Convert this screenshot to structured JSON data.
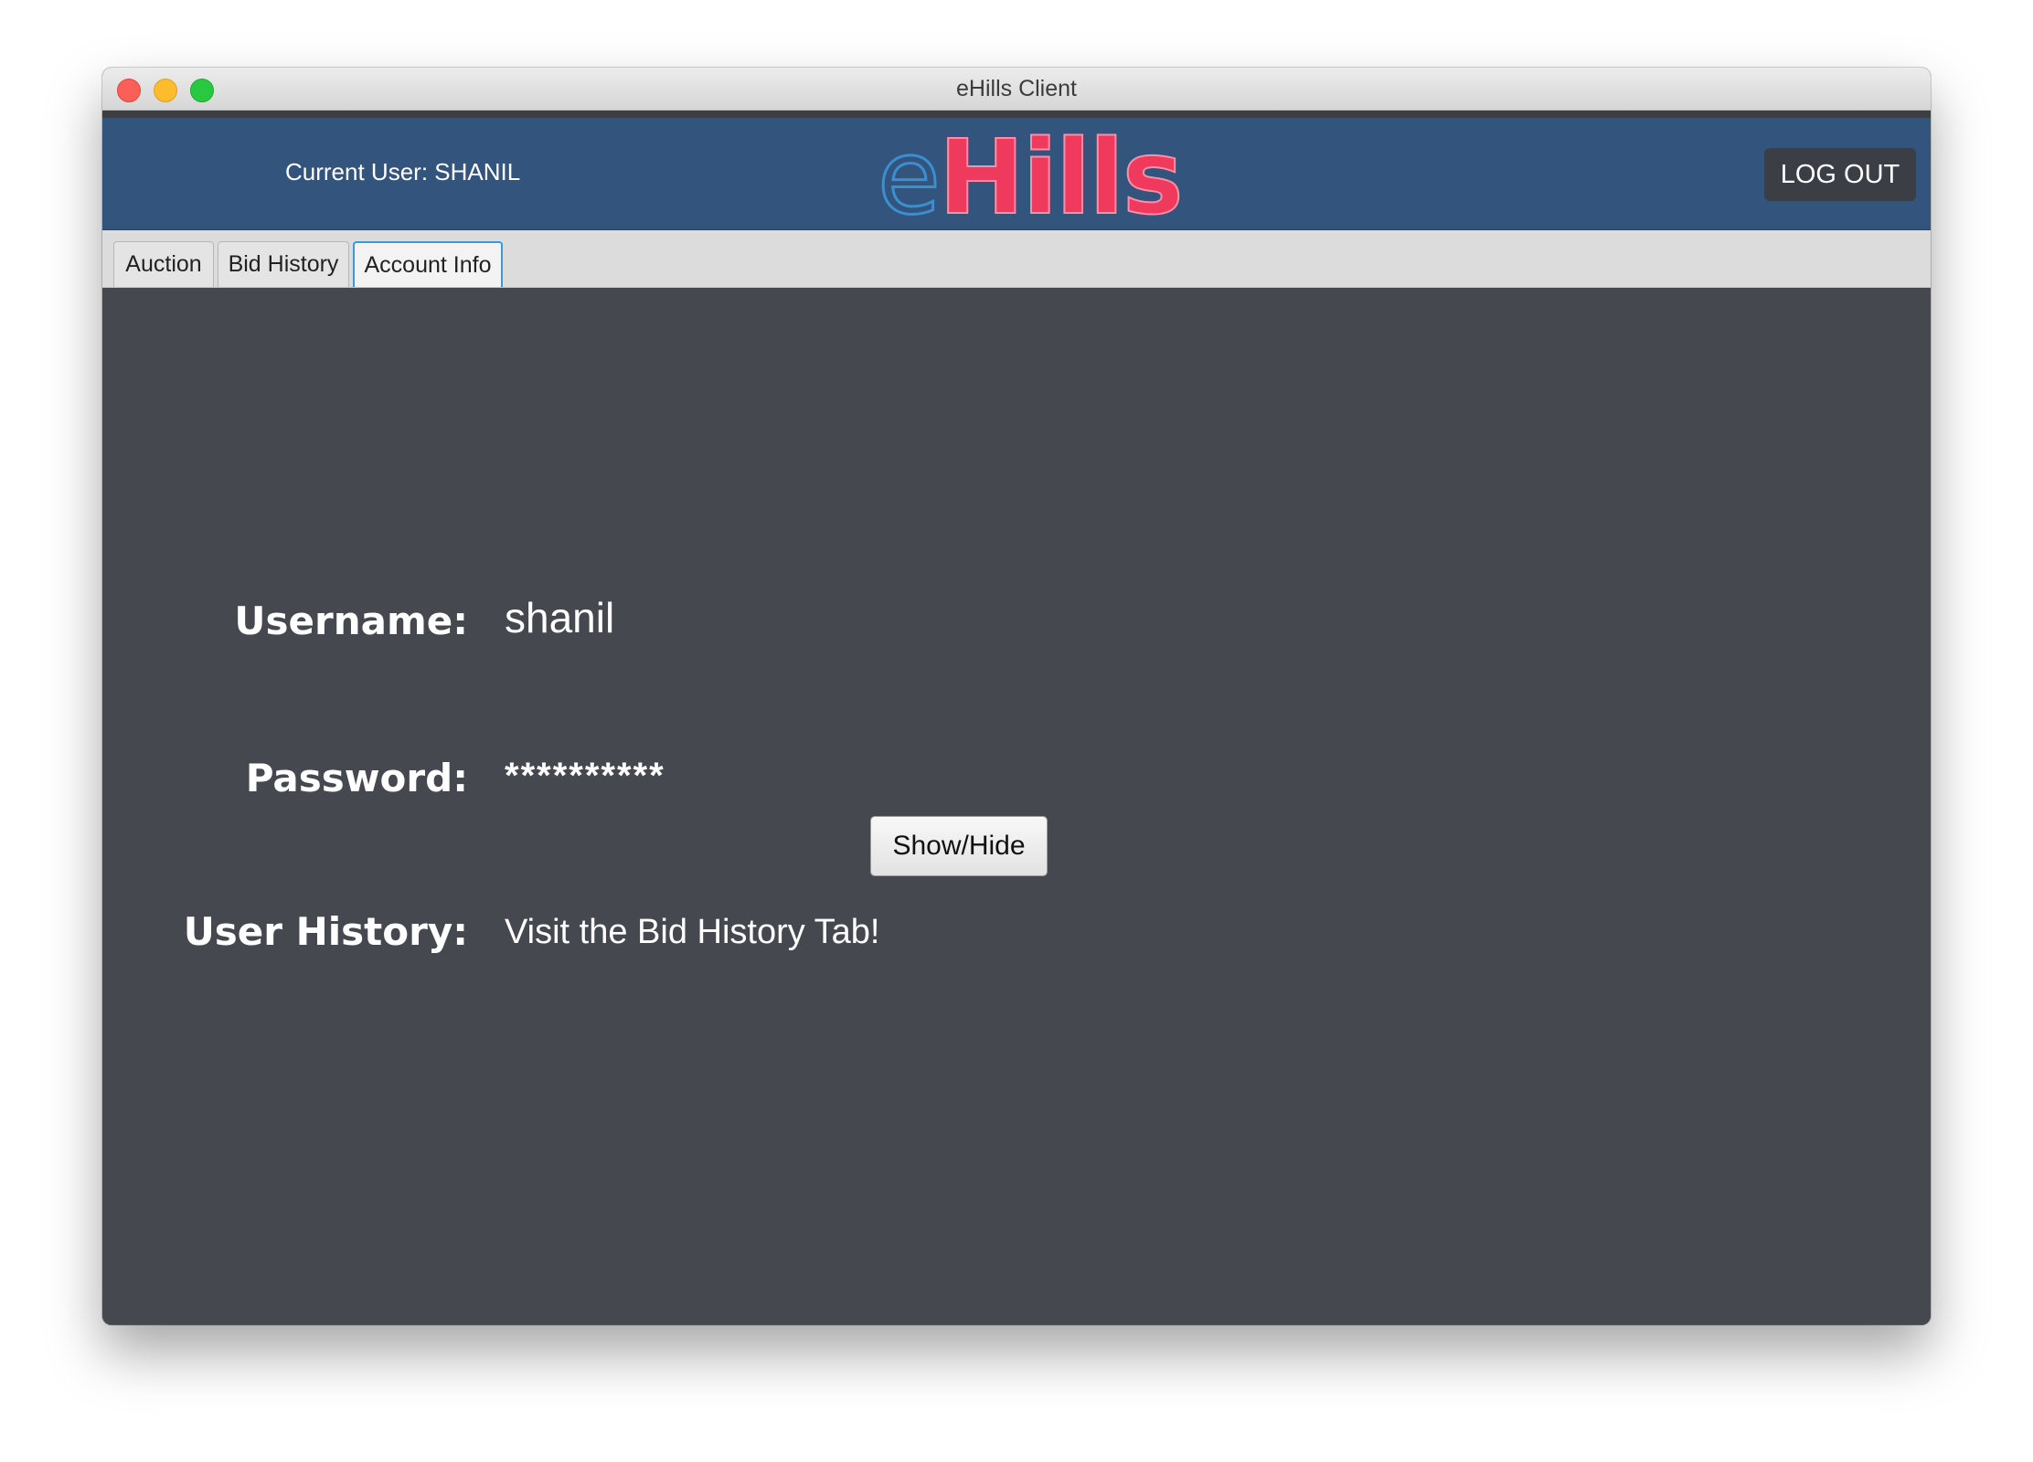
{
  "window": {
    "title": "eHills Client"
  },
  "header": {
    "current_user": "Current User: SHANIL",
    "logo_prefix": "e",
    "logo_main": "Hills",
    "logout_label": "LOG OUT",
    "colors": {
      "header_bg": "#33547d",
      "logo_e": "#3a8fd1",
      "logo_hills": "#ef3a5d"
    }
  },
  "tabs": [
    {
      "label": "Auction",
      "selected": false
    },
    {
      "label": "Bid History",
      "selected": false
    },
    {
      "label": "Account Info",
      "selected": true
    }
  ],
  "account": {
    "username_label": "Username:",
    "username_value": "shanil",
    "password_label": "Password:",
    "password_value": "**********",
    "show_hide_label": "Show/Hide",
    "history_label": "User History:",
    "history_value": "Visit the Bid History Tab!"
  }
}
